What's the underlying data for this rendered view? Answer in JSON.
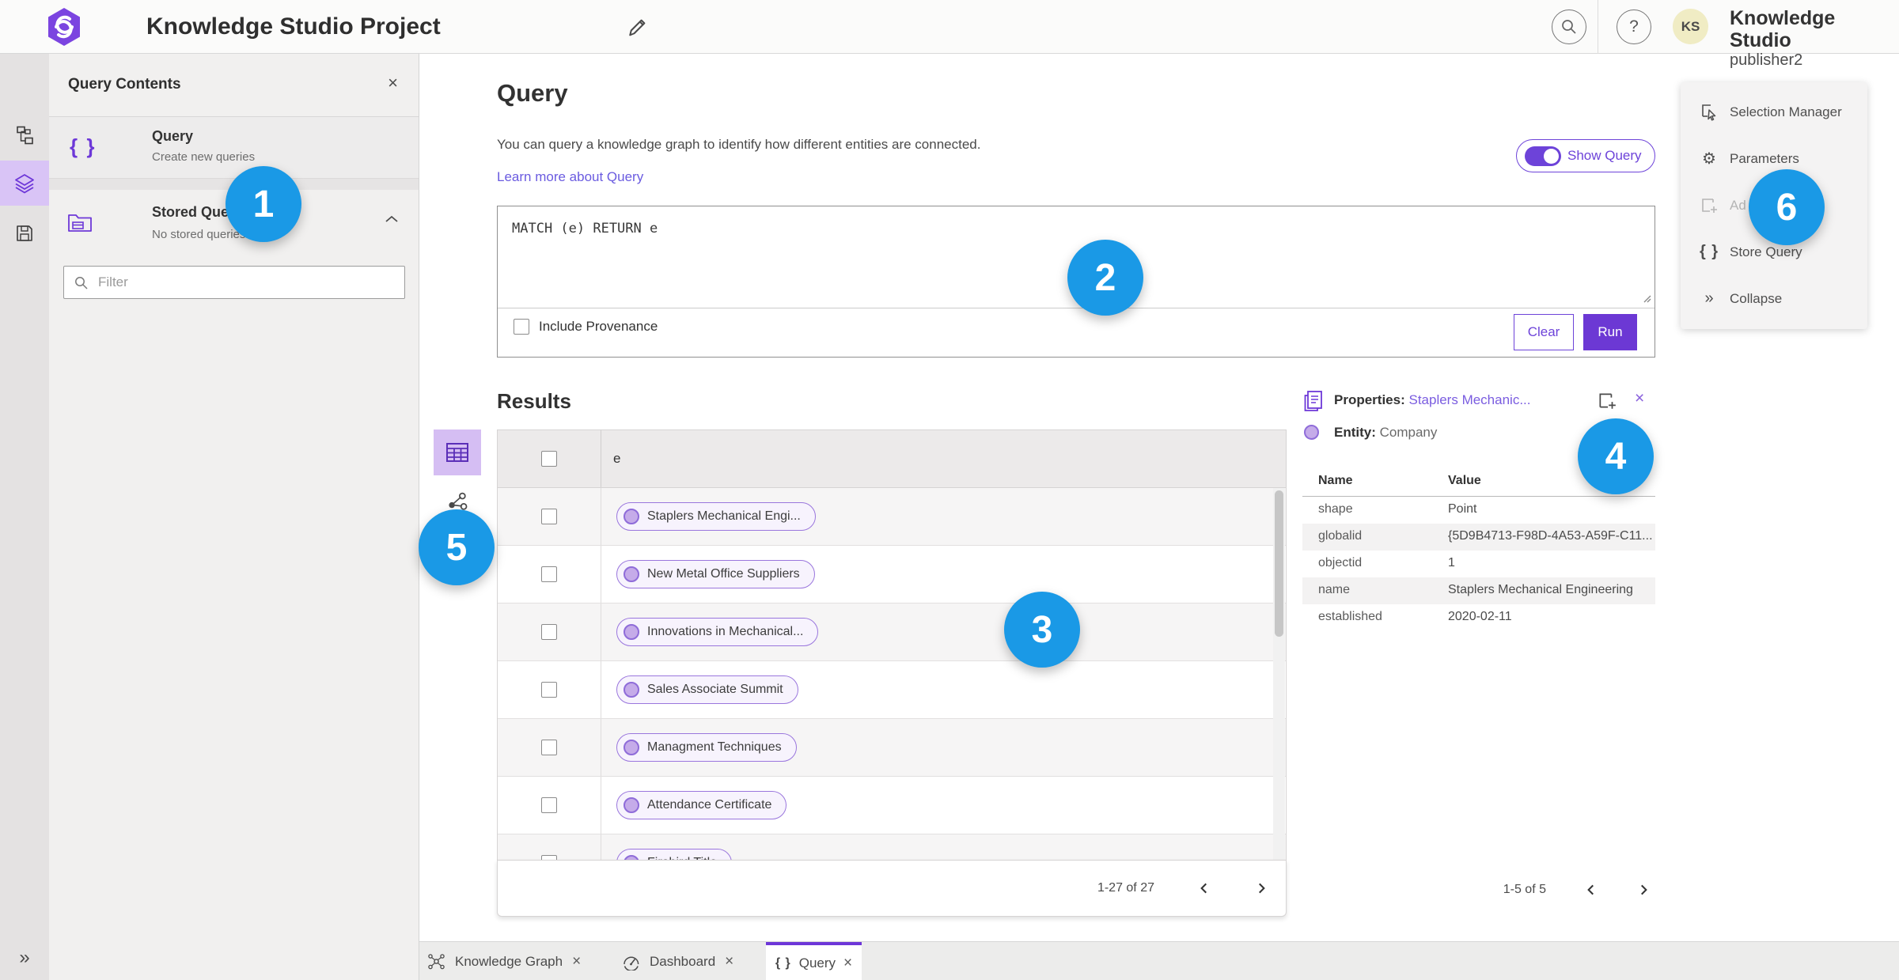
{
  "topbar": {
    "title": "Knowledge Studio Project",
    "account_name": "Knowledge Studio",
    "account_user": "publisher2",
    "avatar_initials": "KS"
  },
  "icons": {
    "close": "×",
    "help": "?",
    "braces": "{ }",
    "collapse_double_chevron": "»",
    "gear": "⚙"
  },
  "panel": {
    "title": "Query Contents",
    "query_item": {
      "title": "Query",
      "subtitle": "Create new queries"
    },
    "stored": {
      "title": "Stored Queries",
      "subtitle": "No stored queries exist"
    },
    "filter_placeholder": "Filter"
  },
  "query": {
    "heading": "Query",
    "description": "You can query a knowledge graph to identify how different entities are connected.",
    "learn_link": "Learn more about Query",
    "toggle_label": "Show Query",
    "code": "MATCH (e) RETURN e",
    "provenance_label": "Include Provenance",
    "clear_label": "Clear",
    "run_label": "Run"
  },
  "results": {
    "heading": "Results",
    "column": "e",
    "rows": [
      "Staplers Mechanical Engi...",
      "New Metal Office Suppliers",
      "Innovations in Mechanical...",
      "Sales Associate Summit",
      "Managment Techniques",
      "Attendance Certificate",
      "Firebird Title"
    ],
    "pagination": "1-27 of 27"
  },
  "properties": {
    "label": "Properties:",
    "selected": "Staplers Mechanic...",
    "entity_label": "Entity:",
    "entity_type": "Company",
    "name_col": "Name",
    "value_col": "Value",
    "rows": [
      {
        "name": "shape",
        "value": "Point"
      },
      {
        "name": "globalid",
        "value": "{5D9B4713-F98D-4A53-A59F-C11..."
      },
      {
        "name": "objectid",
        "value": "1"
      },
      {
        "name": "name",
        "value": "Staplers Mechanical Engineering"
      },
      {
        "name": "established",
        "value": "2020-02-11"
      }
    ],
    "pagination": "1-5 of 5"
  },
  "right_menu": {
    "selection_manager": "Selection Manager",
    "parameters": "Parameters",
    "add_truncated": "Ad",
    "store_query": "Store Query",
    "collapse": "Collapse"
  },
  "tabs": {
    "knowledge_graph": "Knowledge Graph",
    "dashboard": "Dashboard",
    "query": "Query"
  },
  "badges": [
    "1",
    "2",
    "3",
    "4",
    "5",
    "6"
  ],
  "colors": {
    "accent": "#6d38d8",
    "badge_blue": "#1a99e6",
    "link": "#6a5be0"
  }
}
